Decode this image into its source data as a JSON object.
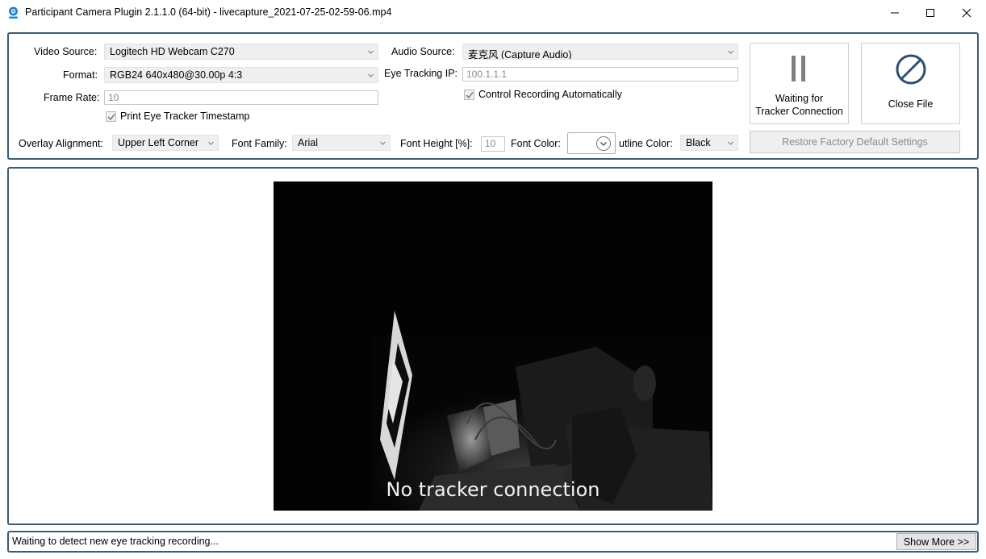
{
  "window": {
    "title": "Participant Camera Plugin 2.1.1.0 (64-bit) - livecapture_2021-07-25-02-59-06.mp4",
    "app_icon": "webcam-icon",
    "controls": [
      "minimize-icon",
      "maximize-icon",
      "close-icon"
    ]
  },
  "settings": {
    "video_source": {
      "label": "Video Source:",
      "value": "Logitech HD Webcam C270"
    },
    "format": {
      "label": "Format:",
      "value": "RGB24 640x480@30.00p 4:3"
    },
    "frame_rate": {
      "label": "Frame Rate:",
      "value": "10"
    },
    "print_timestamp": {
      "label": "Print Eye Tracker Timestamp",
      "checked": true
    },
    "audio_source": {
      "label": "Audio Source:",
      "value": "麦克风 (Capture Audio)"
    },
    "eye_tracking_ip": {
      "label": "Eye Tracking IP:",
      "value": "100.1.1.1"
    },
    "control_recording": {
      "label": "Control Recording Automatically",
      "checked": true
    },
    "overlay_alignment": {
      "label": "Overlay Alignment:",
      "value": "Upper Left Corner"
    },
    "font_family": {
      "label": "Font Family:",
      "value": "Arial"
    },
    "font_height": {
      "label": "Font Height [%]:",
      "value": "10"
    },
    "font_color": {
      "label": "Font Color:",
      "value": "#ffffff"
    },
    "outline_color": {
      "label": "utline Color:",
      "value": "Black"
    },
    "waiting_button": {
      "line1": "Waiting for",
      "line2": "Tracker Connection",
      "icon": "pause-icon"
    },
    "close_file_button": {
      "label": "Close File",
      "icon": "no-entry-icon"
    },
    "restore_button": {
      "label": "Restore Factory Default Settings"
    }
  },
  "preview": {
    "overlay_text": "No tracker connection"
  },
  "status": {
    "text": "Waiting to detect new eye tracking recording...",
    "show_more": "Show More >>"
  }
}
